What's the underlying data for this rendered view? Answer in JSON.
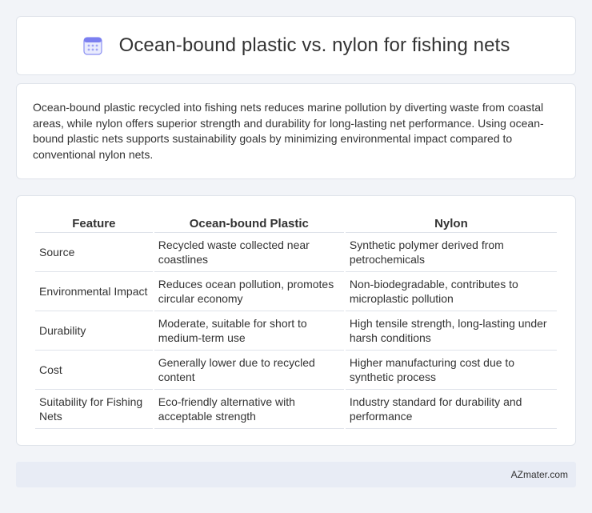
{
  "header": {
    "title": "Ocean-bound plastic vs. nylon for fishing nets",
    "icon": "calendar-icon"
  },
  "summary": {
    "text": "Ocean-bound plastic recycled into fishing nets reduces marine pollution by diverting waste from coastal areas, while nylon offers superior strength and durability for long-lasting net performance. Using ocean-bound plastic nets supports sustainability goals by minimizing environmental impact compared to conventional nylon nets."
  },
  "table": {
    "headers": [
      "Feature",
      "Ocean-bound Plastic",
      "Nylon"
    ],
    "rows": [
      [
        "Source",
        "Recycled waste collected near coastlines",
        "Synthetic polymer derived from petrochemicals"
      ],
      [
        "Environmental Impact",
        "Reduces ocean pollution, promotes circular economy",
        "Non-biodegradable, contributes to microplastic pollution"
      ],
      [
        "Durability",
        "Moderate, suitable for short to medium-term use",
        "High tensile strength, long-lasting under harsh conditions"
      ],
      [
        "Cost",
        "Generally lower due to recycled content",
        "Higher manufacturing cost due to synthetic process"
      ],
      [
        "Suitability for Fishing Nets",
        "Eco-friendly alternative with acceptable strength",
        "Industry standard for durability and performance"
      ]
    ]
  },
  "footer": {
    "brand": "AZmater.com"
  },
  "colors": {
    "background": "#f2f4f8",
    "card": "#ffffff",
    "border": "#dfe3ea",
    "footer": "#e8ecf5",
    "icon_accent": "#7b7ff0"
  }
}
